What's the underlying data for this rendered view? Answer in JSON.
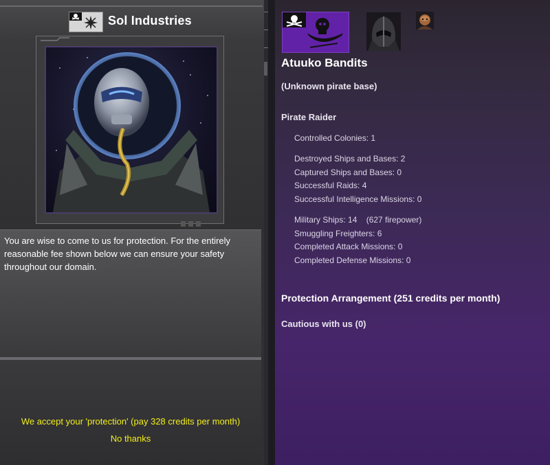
{
  "left_panel": {
    "empire_name": "Sol Industries",
    "empire_flag_icon": "pirate-skull-flag-icon",
    "portrait_description_icon": "pirate-leader-helmet-portrait",
    "message": "You are wise to come to us for protection. For the entirely reasonable fee shown below we can ensure your safety throughout our domain.",
    "responses": [
      "We accept your 'protection' (pay 328 credits per month)",
      "No thanks"
    ]
  },
  "right_panel": {
    "faction_flag_icon": "skull-crossbones-flag-icon",
    "leader_icon": "armored-helmet-portrait-icon",
    "small_portrait_icon": "alien-portrait-icon",
    "faction_name": "Atuuko Bandits",
    "base_type": "(Unknown pirate base)",
    "faction_type": "Pirate Raider",
    "stats": {
      "controlled_colonies": "Controlled Colonies: 1",
      "destroyed": "Destroyed Ships and Bases: 2",
      "captured": "Captured Ships and Bases: 0",
      "raids": "Successful Raids: 4",
      "intel": "Successful Intelligence Missions: 0",
      "military": "Military Ships: 14    (627 firepower)",
      "smuggling": "Smuggling Freighters: 6",
      "attack": "Completed Attack Missions: 0",
      "defense": "Completed Defense Missions: 0"
    },
    "protection": "Protection Arrangement (251 credits per month)",
    "relation": "Cautious with us (0)"
  },
  "colors": {
    "response_text": "#f2ee1a",
    "faction_flag_bg": "#6222a8"
  }
}
